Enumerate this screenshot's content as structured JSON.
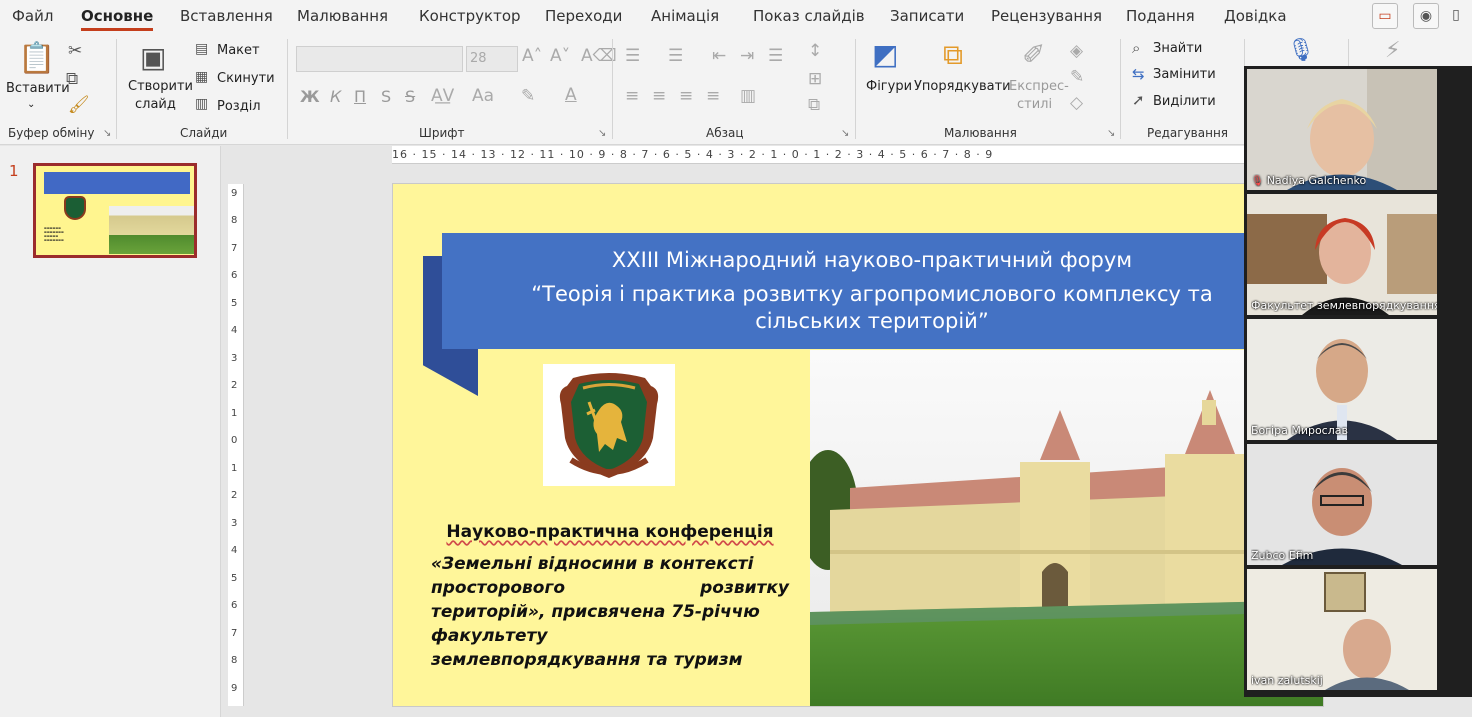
{
  "menu": {
    "tabs": [
      "Файл",
      "Основне",
      "Вставлення",
      "Малювання",
      "Конструктор",
      "Переходи",
      "Анімація",
      "Показ слайдів",
      "Записати",
      "Рецензування",
      "Подання",
      "Довідка"
    ],
    "active_tab": "Основне",
    "accent_color": "#c43e1c"
  },
  "ribbon": {
    "clipboard": {
      "paste": "Вставити",
      "label": "Буфер обміну"
    },
    "slides": {
      "new_slide_line1": "Створити",
      "new_slide_line2": "слайд",
      "layout": "Макет",
      "reset": "Скинути",
      "section": "Розділ",
      "label": "Слайди"
    },
    "font": {
      "size": "28",
      "bold": "Ж",
      "italic": "К",
      "underline": "П",
      "strike": "S",
      "label": "Шрифт"
    },
    "paragraph": {
      "label": "Абзац"
    },
    "drawing": {
      "shapes": "Фігури",
      "arrange": "Упорядкувати",
      "quick_styles_line1": "Експрес-",
      "quick_styles_line2": "стилі",
      "label": "Малювання"
    },
    "editing": {
      "find": "Знайти",
      "replace": "Замінити",
      "select": "Виділити",
      "label": "Редагування"
    }
  },
  "thumbnail": {
    "number": "1"
  },
  "ruler": {
    "horizontal": "16 · 15 · 14 · 13 · 12 · 11 · 10 · 9 · 8 · 7 · 6 · 5 · 4 · 3 · 2 · 1 · 0 · 1 · 2 · 3 · 4 · 5 · 6 · 7 · 8 · 9",
    "vertical": [
      "9",
      "8",
      "7",
      "6",
      "5",
      "4",
      "3",
      "2",
      "1",
      "0",
      "1",
      "2",
      "3",
      "4",
      "5",
      "6",
      "7",
      "8",
      "9"
    ]
  },
  "slide": {
    "banner_line1": "XXIII Міжнародний науково-практичний форум",
    "banner_line2": "“Теорія і практика розвитку агропромислового комплексу та",
    "banner_line3": "сільських територій”",
    "conf_title": "Науково-практична конференція",
    "conf_line1": "«Земельні відносини в контексті",
    "conf_line2": "просторового розвитку",
    "conf_line3": "територій», присвячена 75-річчю",
    "conf_line4": "факультету",
    "conf_line5": "землевпорядкування та туризм",
    "background_color": "#fff69a",
    "banner_color": "#4472c4"
  },
  "participants": [
    {
      "name": "Nadiya Galchenko",
      "muted": true
    },
    {
      "name": "Факультет землевпорядкування та т...",
      "muted": false
    },
    {
      "name": "Богіра Мирослав",
      "muted": false
    },
    {
      "name": "Zubco Efim",
      "muted": false
    },
    {
      "name": "ivan zalutskij",
      "muted": false
    }
  ],
  "icons": [
    "cut-icon",
    "copy-icon",
    "format-painter-icon",
    "paste-icon",
    "new-slide-icon",
    "shapes-icon",
    "arrange-icon",
    "quick-styles-icon",
    "find-icon",
    "replace-icon",
    "select-icon",
    "comments-icon",
    "record-icon",
    "microphone-icon"
  ]
}
